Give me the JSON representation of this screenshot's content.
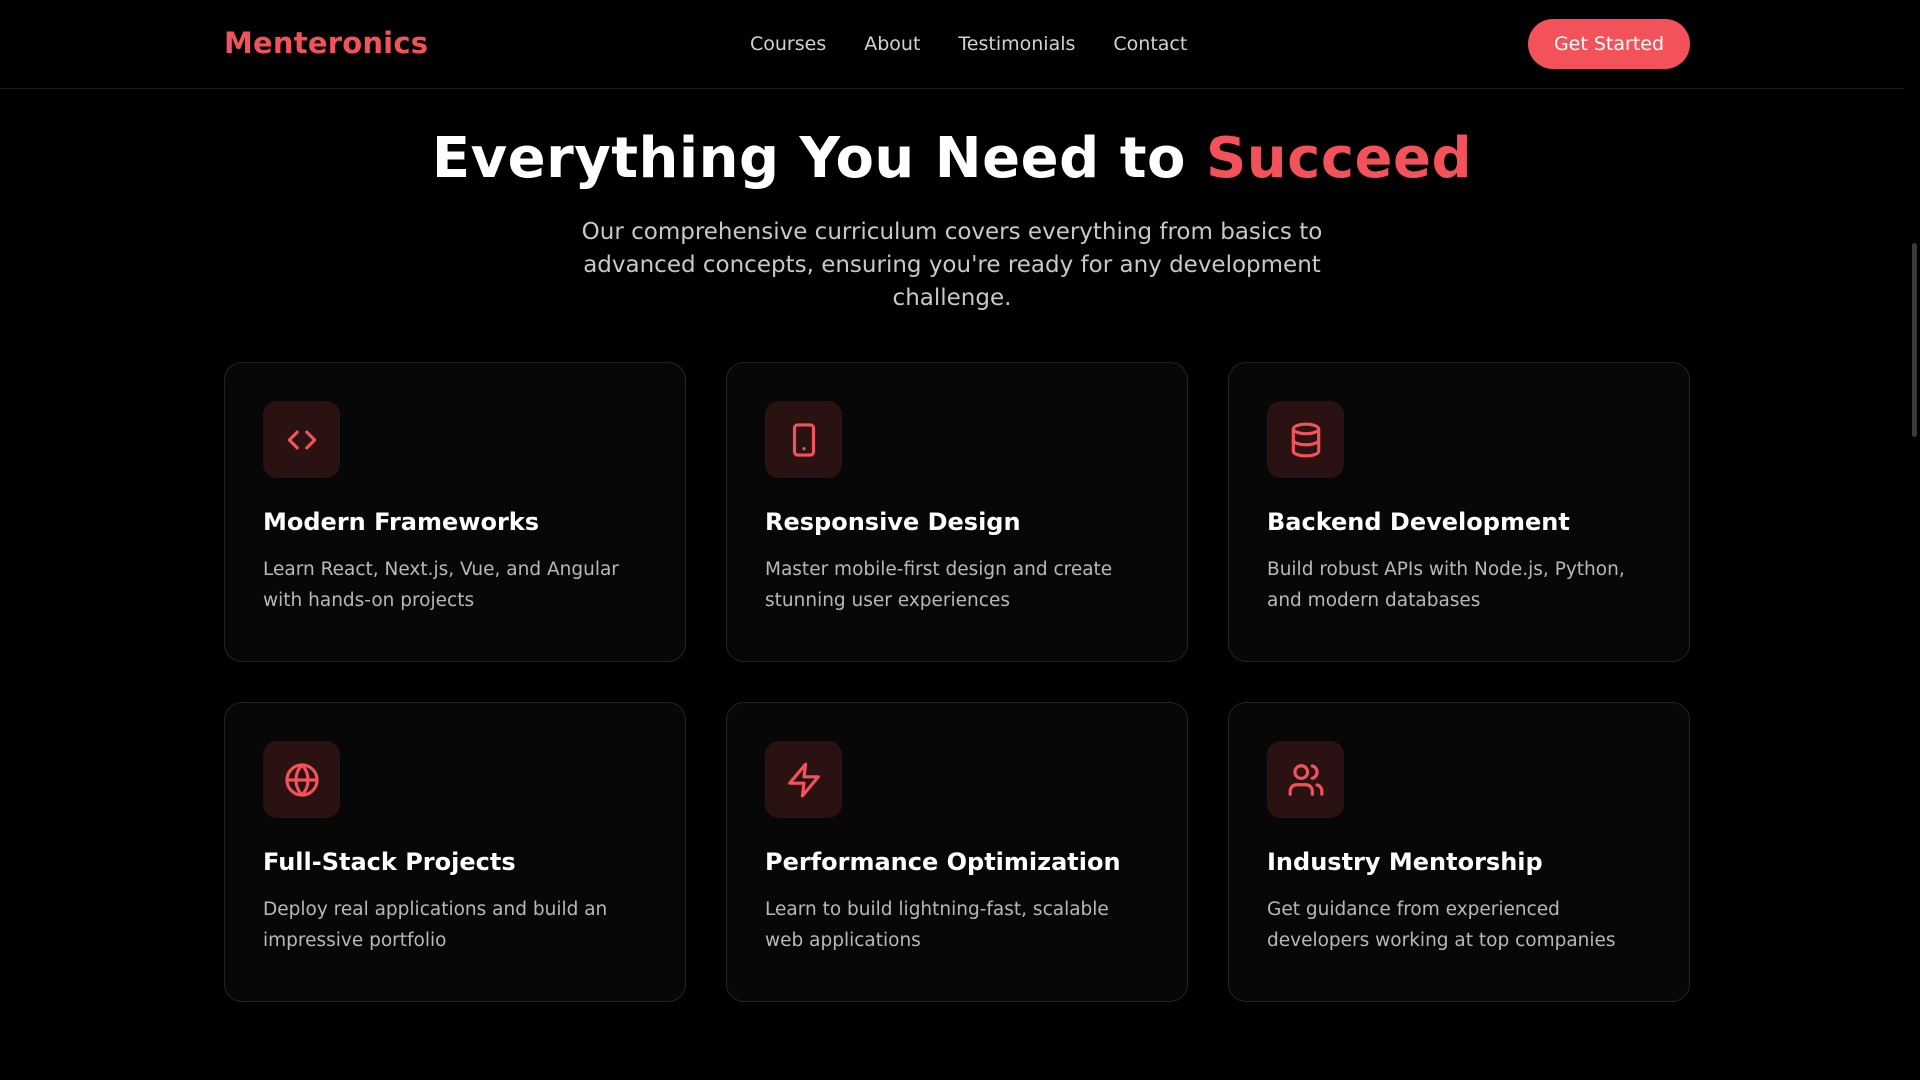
{
  "colors": {
    "accent": "#f4525a",
    "background": "#000000",
    "card": "#080707",
    "icon_bg": "#2a1212"
  },
  "nav": {
    "logo": "Menteronics",
    "links": [
      "Courses",
      "About",
      "Testimonials",
      "Contact"
    ],
    "cta_label": "Get Started"
  },
  "hero": {
    "title_main": "Everything You Need to ",
    "title_accent": "Succeed",
    "subtitle": "Our comprehensive curriculum covers everything from basics to advanced concepts, ensuring you're ready for any development challenge."
  },
  "features": [
    {
      "icon": "code-icon",
      "title": "Modern Frameworks",
      "description": "Learn React, Next.js, Vue, and Angular with hands-on projects"
    },
    {
      "icon": "tablet-icon",
      "title": "Responsive Design",
      "description": "Master mobile-first design and create stunning user experiences"
    },
    {
      "icon": "database-icon",
      "title": "Backend Development",
      "description": "Build robust APIs with Node.js, Python, and modern databases"
    },
    {
      "icon": "globe-icon",
      "title": "Full-Stack Projects",
      "description": "Deploy real applications and build an impressive portfolio"
    },
    {
      "icon": "lightning-icon",
      "title": "Performance Optimization",
      "description": "Learn to build lightning-fast, scalable web applications"
    },
    {
      "icon": "users-icon",
      "title": "Industry Mentorship",
      "description": "Get guidance from experienced developers working at top companies"
    }
  ]
}
